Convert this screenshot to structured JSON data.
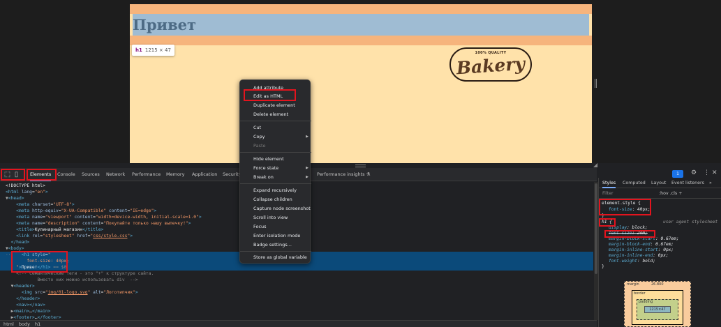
{
  "viewport": {
    "h1_text": "Привет",
    "tooltip": {
      "tag": "h1",
      "dims": "1215 × 47"
    },
    "logo": {
      "top": "100% QUALITY",
      "main": "Bakery"
    }
  },
  "devtools": {
    "tabs": [
      "Elements",
      "Console",
      "Sources",
      "Network",
      "Performance",
      "Memory",
      "Application",
      "Security",
      "Performance insights ⚗"
    ],
    "issues_count": "1",
    "dom_lines": [
      {
        "html": "<span class='tx'>&lt;!DOCTYPE html&gt;</span>"
      },
      {
        "html": "<span class='tg'>&lt;html</span> <span class='at'>lang</span>=<span class='av'>\"en\"</span><span class='tg'>&gt;</span>"
      },
      {
        "html": "<span class='arr'>▼</span><span class='tg'>&lt;head&gt;</span>"
      },
      {
        "html": "    <span class='tg'>&lt;meta</span> <span class='at'>charset</span>=<span class='av'>\"UTF-8\"</span><span class='tg'>&gt;</span>"
      },
      {
        "html": "    <span class='tg'>&lt;meta</span> <span class='at'>http-equiv</span>=<span class='av'>\"X-UA-Compatible\"</span> <span class='at'>content</span>=<span class='av'>\"IE=edge\"</span><span class='tg'>&gt;</span>"
      },
      {
        "html": "    <span class='tg'>&lt;meta</span> <span class='at'>name</span>=<span class='av'>\"viewport\"</span> <span class='at'>content</span>=<span class='av'>\"width=device-width, initial-scale=1.0\"</span><span class='tg'>&gt;</span>"
      },
      {
        "html": "    <span class='tg'>&lt;meta</span> <span class='at'>name</span>=<span class='av'>\"description\"</span> <span class='at'>content</span>=<span class='av'>\"Покупайте только нашу выпечку!\"</span><span class='tg'>&gt;</span>"
      },
      {
        "html": "    <span class='tg'>&lt;title&gt;</span><span class='tx'>Кулинарный магазин</span><span class='tg'>&lt;/title&gt;</span>"
      },
      {
        "html": "    <span class='tg'>&lt;link</span> <span class='at'>rel</span>=<span class='av'>\"stylesheet\"</span> <span class='at'>href</span>=<span class='av'>\"<u>css/style.css</u>\"</span><span class='tg'>&gt;</span>"
      },
      {
        "html": "  <span class='tg'>&lt;/head&gt;</span>"
      },
      {
        "html": "<span class='arr'>▼</span><span class='tg'>&lt;body&gt;</span>"
      },
      {
        "html": "<span class='cm'>···</span>   <span class='tg'>&lt;h1</span> <span class='at'>style</span>=<span class='av'>\"</span>"
      },
      {
        "html": "        <span class='av'>font-size: 40px;</span>"
      },
      {
        "html": "    <span class='av'>\"</span><span class='tg'>&gt;</span><span class='tx'>Привет</span><span class='tg'>&lt;/h1&gt;</span> <span class='cm'>== $0</span>"
      },
      {
        "html": "    <span class='cm'>&lt;!-- Семантические теги - это \"+\" к структуре сайта.</span>"
      },
      {
        "html": "    <span class='cm'>        Вместо них можно использовать div  --&gt;</span>"
      },
      {
        "html": "  <span class='arr'>▼</span><span class='tg'>&lt;header&gt;</span>"
      },
      {
        "html": "      <span class='tg'>&lt;img</span> <span class='at'>src</span>=<span class='av'>\"<u>img/01-logo.svg</u>\"</span> <span class='at'>alt</span>=<span class='av'>\"Логотипчик\"</span><span class='tg'>&gt;</span>"
      },
      {
        "html": "    <span class='tg'>&lt;/header&gt;</span>"
      },
      {
        "html": "    <span class='tg'>&lt;nav&gt;&lt;/nav&gt;</span>"
      },
      {
        "html": "  <span class='arr'>▶</span><span class='tg'>&lt;main&gt;</span><span class='tx'>…</span><span class='tg'>&lt;/main&gt;</span>"
      },
      {
        "html": "  <span class='arr'>▶</span><span class='tg'>&lt;footer&gt;</span><span class='tx'>…</span><span class='tg'>&lt;/footer&gt;</span>"
      }
    ],
    "breadcrumbs": [
      "html",
      "body",
      "h1"
    ],
    "styles_tabs": [
      "Styles",
      "Computed",
      "Layout",
      "Event listeners",
      "»"
    ],
    "filter_placeholder": "Filter",
    "filter_tools": ":hov  .cls  +",
    "element_style": {
      "selector": "element.style {",
      "prop": "font-size",
      "value": "40px;"
    },
    "ua_rule": {
      "selector": "h1 {",
      "source": "user agent stylesheet",
      "props": [
        {
          "p": "display",
          "v": "block;"
        },
        {
          "p": "font-size",
          "v": "2em;"
        },
        {
          "p": "margin-block-start",
          "v": "0.67em;"
        },
        {
          "p": "margin-block-end",
          "v": "0.67em;"
        },
        {
          "p": "margin-inline-start",
          "v": "0px;"
        },
        {
          "p": "margin-inline-end",
          "v": "0px;"
        },
        {
          "p": "font-weight",
          "v": "bold;"
        }
      ]
    },
    "box_model": {
      "margin_label": "margin",
      "margin_value": "26.800",
      "border_label": "border",
      "padding_label": "padding",
      "content": "1215×47"
    }
  },
  "context_menu": {
    "items": [
      {
        "label": "Add attribute"
      },
      {
        "label": "Edit as HTML"
      },
      {
        "label": "Duplicate element"
      },
      {
        "label": "Delete element"
      },
      {
        "label": "Cut"
      },
      {
        "label": "Copy"
      },
      {
        "label": "Paste"
      },
      {
        "label": "Hide element"
      },
      {
        "label": "Force state"
      },
      {
        "label": "Break on"
      },
      {
        "label": "Expand recursively"
      },
      {
        "label": "Collapse children"
      },
      {
        "label": "Capture node screenshot"
      },
      {
        "label": "Scroll into view"
      },
      {
        "label": "Focus"
      },
      {
        "label": "Enter isolation mode"
      },
      {
        "label": "Badge settings..."
      },
      {
        "label": "Store as global variable"
      }
    ]
  },
  "colors": {
    "highlight": "#e3141e",
    "selected_row": "#0b4a7a",
    "page_bg": "#ffe2aa",
    "h1_margin": "#f6b47c",
    "h1_content": "#9fbcd3"
  }
}
